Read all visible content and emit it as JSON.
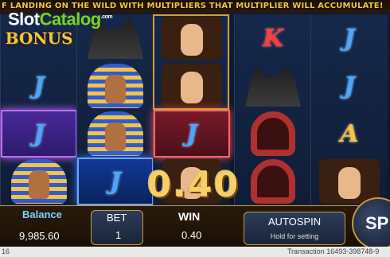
{
  "ticker_text": "F  LANDING ON THE WILD WITH MULTIPLIERS THAT MULTIPLIER WILL ACCUMULATE!",
  "logo": {
    "part1": "Slot",
    "part2": "Catalog",
    "part3": ".com"
  },
  "reels": [
    [
      {
        "sym": "bonus",
        "label": "BONUS"
      },
      {
        "sym": "J"
      },
      {
        "sym": "J",
        "hl": "purple"
      },
      {
        "sym": "pharaoh"
      }
    ],
    [
      {
        "sym": "jackal"
      },
      {
        "sym": "pharaoh"
      },
      {
        "sym": "pharaoh"
      },
      {
        "sym": "J",
        "hl": "blue"
      }
    ],
    [
      {
        "sym": "cleopatra"
      },
      {
        "sym": "cleopatra"
      },
      {
        "sym": "J",
        "hl": "red"
      },
      {
        "sym": "cleopatra"
      }
    ],
    [
      {
        "sym": "K"
      },
      {
        "sym": "jackal"
      },
      {
        "sym": "cobra"
      },
      {
        "sym": "cobra"
      }
    ],
    [
      {
        "sym": "J"
      },
      {
        "sym": "J"
      },
      {
        "sym": "A"
      },
      {
        "sym": "cleopatra"
      }
    ]
  ],
  "win_amount_display": "0.40",
  "balance": {
    "label": "Balance",
    "value": "9,985.60"
  },
  "bet": {
    "label": "BET",
    "value": "1"
  },
  "win": {
    "label": "WIN",
    "value": "0.40"
  },
  "autospin": {
    "label": "AUTOSPIN",
    "hint": "Hold for setting"
  },
  "spin": {
    "label": "SP"
  },
  "status": {
    "left": "16",
    "transaction": "Transaction 16493-398748-9"
  },
  "colors": {
    "gold": "#f4c542",
    "green": "#7bd321",
    "blue_label": "#7bd4ff"
  }
}
